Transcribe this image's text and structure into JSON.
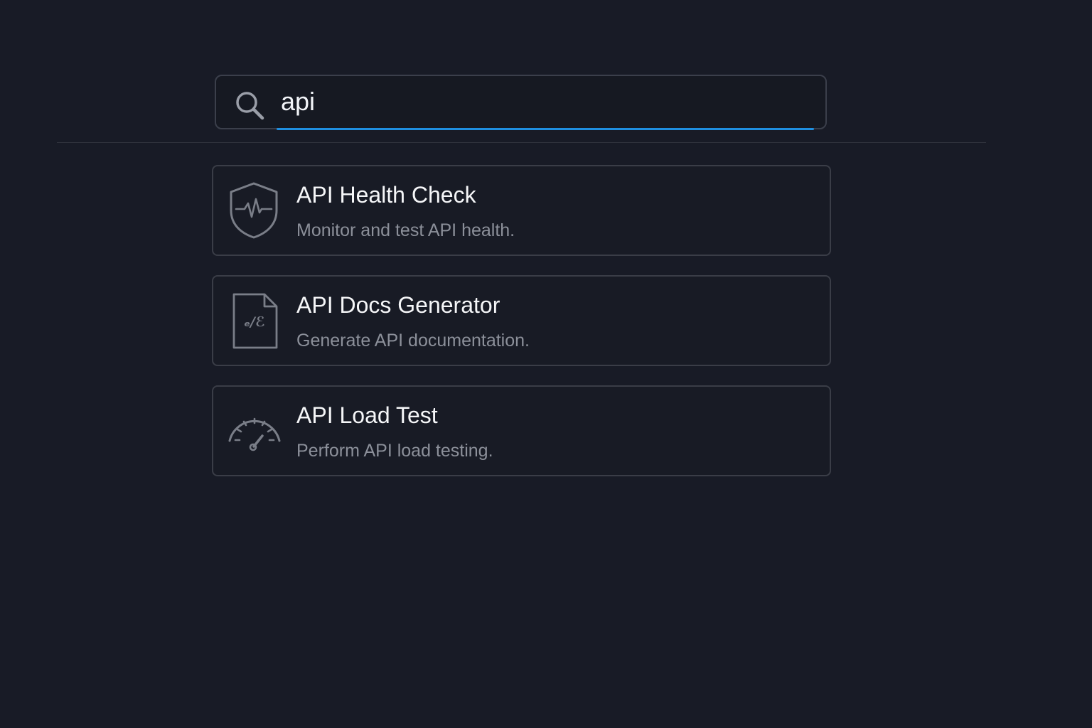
{
  "search": {
    "value": "api",
    "icon": "search-icon"
  },
  "results": [
    {
      "title": "API Health Check",
      "description": "Monitor and test API health.",
      "icon": "shield-pulse-icon"
    },
    {
      "title": "API Docs Generator",
      "description": "Generate API documentation.",
      "icon": "code-document-icon",
      "icon_glyph": "ₑ/ℰ"
    },
    {
      "title": "API Load Test",
      "description": "Perform API load testing.",
      "icon": "speedometer-icon"
    }
  ],
  "colors": {
    "background": "#181b26",
    "accent": "#1f8fe0",
    "border": "#3a3d47",
    "title_text": "#f5f6f8",
    "description_text": "#8c909a"
  }
}
